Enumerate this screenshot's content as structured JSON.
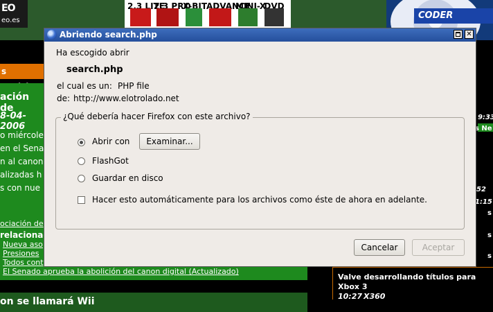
{
  "background": {
    "logo_text": "eo.es",
    "logo_big": "EO",
    "banner_items": [
      "2.3 LITE",
      "2.3 PRO",
      "X-BIT",
      "ADVANCE",
      "MINI-X",
      "DVD"
    ],
    "cd_logo": "CODER",
    "orange_tab": "s Noticias",
    "left_title": "ación de",
    "left_date": "8-04-2006",
    "left_lines": [
      "o miércole",
      "en el Sena",
      "n al canon",
      "alizadas h",
      "s con nue"
    ],
    "left_link1": "ociación de",
    "left_related": "relacionad",
    "left_sublinks": [
      "Nueva aso",
      "Presiones",
      "Todos cont"
    ],
    "senado_link": "El Senado aprueba la abolición del canon digital (Actualizado)",
    "wii_text": "on se llamará Wii",
    "right_news_title": "Valve desarrollando títulos para Xbox 3",
    "right_news_time": "10:27",
    "right_news_tag": "X360",
    "right_snips": [
      "9:33",
      "s Ne",
      "52",
      "1:15",
      "s",
      "s",
      "s"
    ]
  },
  "dialog": {
    "title": "Abriendo search.php",
    "intro": "Ha escogido abrir",
    "filename": "search.php",
    "type_label": "el cual es un:",
    "type_value": "PHP file",
    "from_label": "de:",
    "from_value": "http://www.elotrolado.net",
    "question": "¿Qué debería hacer Firefox con este archivo?",
    "options": {
      "open_with": "Abrir con",
      "flashgot": "FlashGot",
      "save": "Guardar en disco"
    },
    "browse_label": "Examinar...",
    "auto_label": "Hacer esto automáticamente para los archivos como éste de ahora en adelante.",
    "cancel_label": "Cancelar",
    "accept_label": "Aceptar",
    "close_glyph": "✕"
  },
  "colors": {
    "titlebar": "#2f5ca8",
    "dialog_bg": "#efebe7",
    "page_green": "#1e8a1e",
    "page_orange": "#e07000"
  }
}
